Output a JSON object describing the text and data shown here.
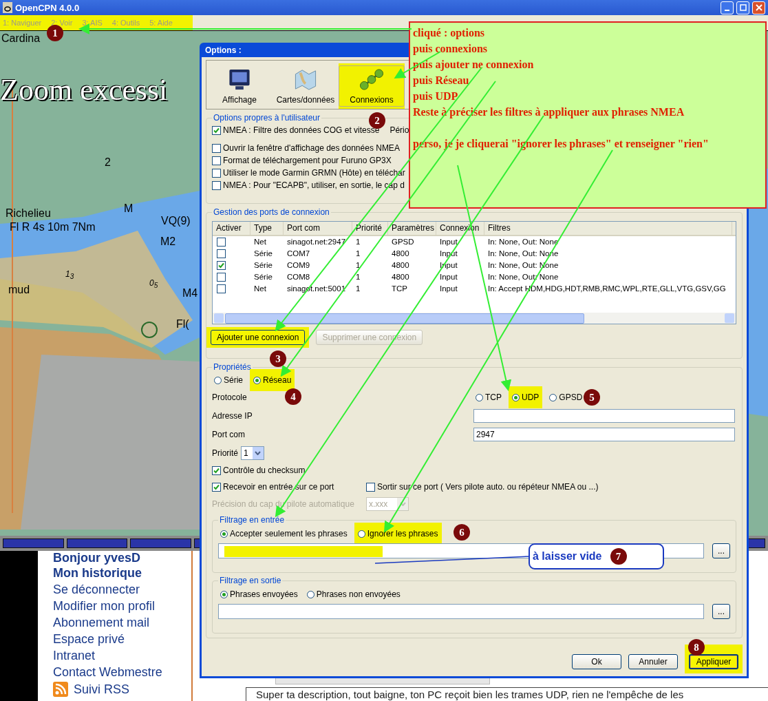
{
  "app_window": {
    "title": "OpenCPN 4.0.0",
    "menu_highlighted": true,
    "menu": [
      "1: Naviguer",
      "2: Voir",
      "3: AIS",
      "4: Outils",
      "5: Aide"
    ]
  },
  "chart": {
    "labels": [
      {
        "text": "Cardina",
        "kind": "plain"
      },
      {
        "text": "Zoom excessi",
        "kind": "banner"
      },
      {
        "text": "2",
        "kind": "plain"
      },
      {
        "text": "Richelieu",
        "kind": "plain"
      },
      {
        "text": "Fl R 4s 10m 7Nm",
        "kind": "plain"
      },
      {
        "text": "M",
        "kind": "plain"
      },
      {
        "text": "VQ(9)",
        "kind": "plain"
      },
      {
        "text": "M2",
        "kind": "plain"
      },
      {
        "text": "1$_{3}$",
        "kind": "sounding"
      },
      {
        "text": "mud",
        "kind": "plain"
      },
      {
        "text": "0$_{5}$",
        "kind": "sounding"
      },
      {
        "text": "M4",
        "kind": "plain"
      },
      {
        "text": "Fl(",
        "kind": "plain"
      }
    ]
  },
  "web_page": {
    "greeting": "Bonjour yvesD",
    "links": [
      "Mon historique",
      "Se déconnecter",
      "Modifier mon profil",
      "Abonnement mail",
      "Espace privé",
      "Intranet",
      "Contact Webmestre"
    ],
    "rss": "Suivi RSS",
    "comment": "Super ta description, tout baigne, ton PC reçoit bien les trames UDP, rien ne l'empêche de les"
  },
  "dialog": {
    "title": "Options :",
    "tabs": [
      {
        "label": "Affichage",
        "selected": false,
        "highlighted": false
      },
      {
        "label": "Cartes/données",
        "selected": false,
        "highlighted": false
      },
      {
        "label": "Connexions",
        "selected": true,
        "highlighted": true
      }
    ],
    "user_options": {
      "legend": "Options propres à l'utilisateur",
      "period_label": "Pério",
      "options": [
        {
          "label": "NMEA : Filtre des données COG et vitesse",
          "checked": true
        },
        {
          "label": "Ouvrir la fenêtre d'affichage des données NMEA",
          "checked": false
        },
        {
          "label": "Format de téléchargement pour Furuno GP3X",
          "checked": false
        },
        {
          "label": "Utiliser le mode Garmin GRMN (Hôte) en téléchar",
          "checked": false
        },
        {
          "label": "NMEA : Pour \"ECAPB\", utiliser, en sortie, le cap d",
          "checked": false
        }
      ]
    },
    "ports": {
      "legend": "Gestion des ports de connexion",
      "check_column": "Activer",
      "columns": [
        "Type",
        "Port com",
        "Priorité",
        "Paramètres",
        "Connexion",
        "Filtres"
      ],
      "rows": [
        {
          "checked": false,
          "cells": [
            "Net",
            "sinagot.net:2947",
            "1",
            "GPSD",
            "Input",
            "In: None, Out: None"
          ]
        },
        {
          "checked": false,
          "cells": [
            "Série",
            "COM7",
            "1",
            "4800",
            "Input",
            "In: None, Out: None"
          ]
        },
        {
          "checked": true,
          "cells": [
            "Série",
            "COM9",
            "1",
            "4800",
            "Input",
            "In: None, Out: None"
          ]
        },
        {
          "checked": false,
          "cells": [
            "Série",
            "COM8",
            "1",
            "4800",
            "Input",
            "In: None, Out: None"
          ]
        },
        {
          "checked": false,
          "cells": [
            "Net",
            "sinagot.net:5001",
            "1",
            "TCP",
            "Input",
            "In: Accept HDM,HDG,HDT,RMB,RMC,WPL,RTE,GLL,VTG,GSV,GG"
          ]
        }
      ],
      "buttons": [
        {
          "label": "Ajouter une connexion",
          "disabled": false,
          "highlighted": true
        },
        {
          "label": "Supprimer une connexion",
          "disabled": true,
          "highlighted": false
        }
      ]
    },
    "properties": {
      "legend": "Propriétés",
      "port_types": [
        {
          "label": "Série",
          "selected": false,
          "highlighted": false
        },
        {
          "label": "Réseau",
          "selected": true,
          "highlighted": true
        }
      ],
      "protocol_label": "Protocole",
      "protocols": [
        {
          "label": "TCP",
          "selected": false,
          "highlighted": false
        },
        {
          "label": "UDP",
          "selected": true,
          "highlighted": true
        },
        {
          "label": "GPSD",
          "selected": false,
          "highlighted": false
        }
      ],
      "ip_label": "Adresse IP",
      "port_label": "Port com",
      "port_value": "2947",
      "priority_label": "Priorité",
      "priority_value": "1",
      "checksum": {
        "label": "Contrôle du checksum",
        "checked": true
      },
      "receive": {
        "label": "Recevoir en entrée sur ce port",
        "checked": true
      },
      "send": {
        "label": "Sortir sur ce port ( Vers pilote auto. ou répéteur NMEA ou ...)",
        "checked": false
      },
      "precision": {
        "label": "Précision du cap du pilote automatique",
        "value": "x.xxx",
        "disabled": true
      }
    },
    "input_filter": {
      "legend": "Filtrage en entrée",
      "field_highlighted": true,
      "modes": [
        {
          "label": "Accepter seulement les phrases",
          "selected": true,
          "highlighted": false
        },
        {
          "label": "Ignorer les phrases",
          "selected": false,
          "highlighted": true
        }
      ],
      "browse": "..."
    },
    "output_filter": {
      "legend": "Filtrage en sortie",
      "modes": [
        {
          "label": "Phrases envoyées",
          "selected": true,
          "highlighted": false
        },
        {
          "label": "Phrases non envoyées",
          "selected": false,
          "highlighted": false
        }
      ],
      "browse": "..."
    },
    "buttons": [
      {
        "label": "Ok",
        "default": false,
        "highlighted": false
      },
      {
        "label": "Annuler",
        "default": false,
        "highlighted": false
      },
      {
        "label": "Appliquer",
        "default": true,
        "highlighted": true
      }
    ]
  },
  "annotations": {
    "note": [
      "cliqué : options",
      "puis connexions",
      "puis ajouter ne connexion",
      "puis Réseau",
      "puis UDP",
      "Reste à préciser les filtres à appliquer aux phrases NMEA",
      "perso, je je cliquerai \"ignorer les phrases\" et renseigner \"rien\""
    ],
    "markers": [
      "1",
      "2",
      "3",
      "4",
      "5",
      "6",
      "7",
      "8"
    ],
    "callout": "à laisser vide"
  }
}
